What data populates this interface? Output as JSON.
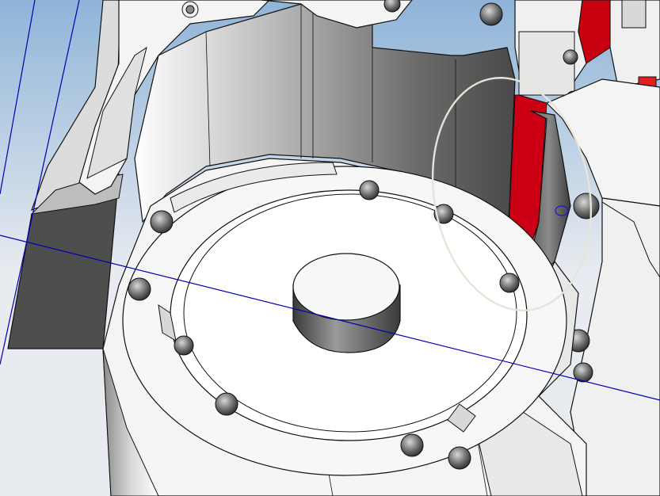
{
  "viewport": {
    "background_top": "#8fb4d8",
    "background_bottom": "#e8ebf0"
  },
  "model": {
    "body_color": "#f4f4f4",
    "shade_color": "#5e5e5e",
    "edge_color": "#111111",
    "cutaway_color": "#d00010",
    "highlight_part_color": "#e02020"
  },
  "overlays": {
    "datum_line_color": "#0000b0",
    "selection_circle_color": "#e8e4d8",
    "point_marker_color": "#1a1ad0"
  },
  "icons": {
    "datum_point": "small-circle-marker",
    "selection": "ellipse-highlight"
  }
}
